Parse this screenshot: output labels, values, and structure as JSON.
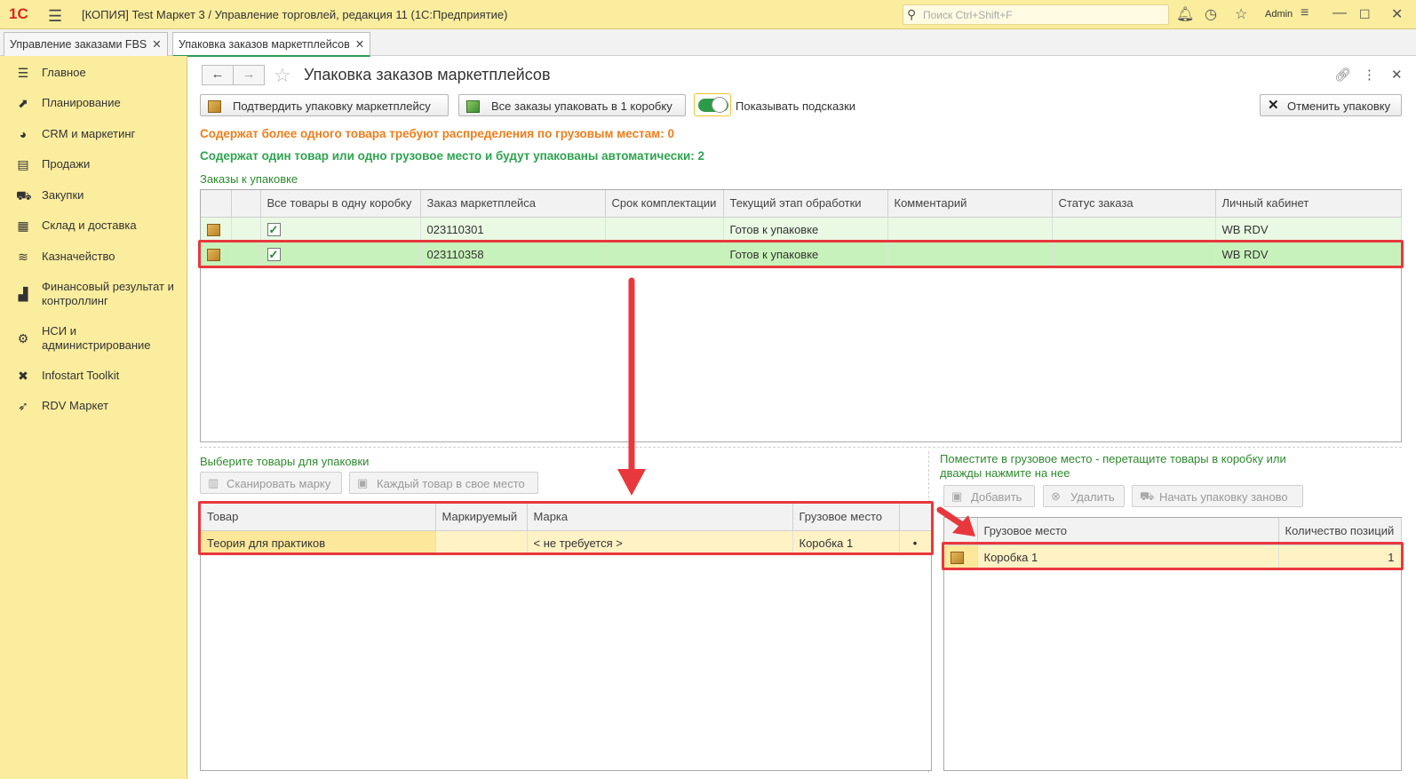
{
  "titlebar": {
    "logo": "1С",
    "title": "[КОПИЯ] Test Маркет 3 / Управление торговлей, редакция 11  (1С:Предприятие)",
    "search_placeholder": "Поиск Ctrl+Shift+F",
    "user": "Admin"
  },
  "tabs": [
    {
      "label": "Управление заказами FBS"
    },
    {
      "label": "Упаковка заказов маркетплейсов"
    }
  ],
  "sidebar": {
    "items": [
      {
        "label": "Главное",
        "icon": "list-icon"
      },
      {
        "label": "Планирование",
        "icon": "chart-line-icon"
      },
      {
        "label": "CRM и маркетинг",
        "icon": "pie-chart-icon"
      },
      {
        "label": "Продажи",
        "icon": "bag-icon"
      },
      {
        "label": "Закупки",
        "icon": "cart-icon"
      },
      {
        "label": "Склад и доставка",
        "icon": "grid-icon"
      },
      {
        "label": "Казначейство",
        "icon": "coins-icon"
      },
      {
        "label": "Финансовый результат и контроллинг",
        "icon": "bar-chart-icon"
      },
      {
        "label": "НСИ и администрирование",
        "icon": "gear-icon"
      },
      {
        "label": "Infostart Toolkit",
        "icon": "tools-icon"
      },
      {
        "label": "RDV Маркет",
        "icon": "rocket-icon"
      }
    ]
  },
  "form": {
    "title": "Упаковка заказов маркетплейсов",
    "confirm_button": "Подтвердить упаковку маркетплейсу",
    "pack_all_button": "Все заказы упаковать в 1 коробку",
    "show_hints_label": "Показывать подсказки",
    "show_hints": true,
    "cancel_button": "Отменить упаковку",
    "info_multi": "Содержат более одного товара требуют распределения по грузовым местам: 0",
    "info_single": "Содержат один товар или одно грузовое место и будут упакованы автоматически: 2",
    "orders_section": "Заказы к упаковке"
  },
  "orders_table": {
    "columns": [
      "",
      "",
      "Все товары в одну коробку",
      "Заказ маркетплейса",
      "Срок комплектации",
      "Текущий этап обработки",
      "Комментарий",
      "Статус заказа",
      "Личный кабинет"
    ],
    "rows": [
      {
        "all_in_one": true,
        "order": "023110301",
        "deadline": "",
        "stage": "Готов к упаковке",
        "comment": "",
        "status": "",
        "cabinet": "WB RDV"
      },
      {
        "all_in_one": true,
        "order": "023110358",
        "deadline": "",
        "stage": "Готов к упаковке",
        "comment": "",
        "status": "",
        "cabinet": "WB RDV"
      }
    ]
  },
  "goods": {
    "section": "Выберите товары для упаковки",
    "scan_button": "Сканировать марку",
    "each_button": "Каждый товар в свое место",
    "columns": [
      "Товар",
      "Маркируемый",
      "Марка",
      "Грузовое место",
      ""
    ],
    "rows": [
      {
        "product": "Теория для практиков",
        "marked": "",
        "mark": "< не требуется >",
        "place": "Коробка 1",
        "dot": "•"
      }
    ]
  },
  "places": {
    "section": "Поместите в грузовое место - перетащите товары в коробку или дважды нажмите на нее",
    "add_button": "Добавить",
    "delete_button": "Удалить",
    "restart_button": "Начать упаковку заново",
    "columns": [
      "",
      "Грузовое место",
      "Количество позиций"
    ],
    "rows": [
      {
        "place": "Коробка 1",
        "count": "1"
      }
    ]
  },
  "colors": {
    "accent_yellow": "#fbed9e",
    "highlight_red": "#e8383d",
    "orange_text": "#f07d1a",
    "green_text": "#2ea44f"
  }
}
